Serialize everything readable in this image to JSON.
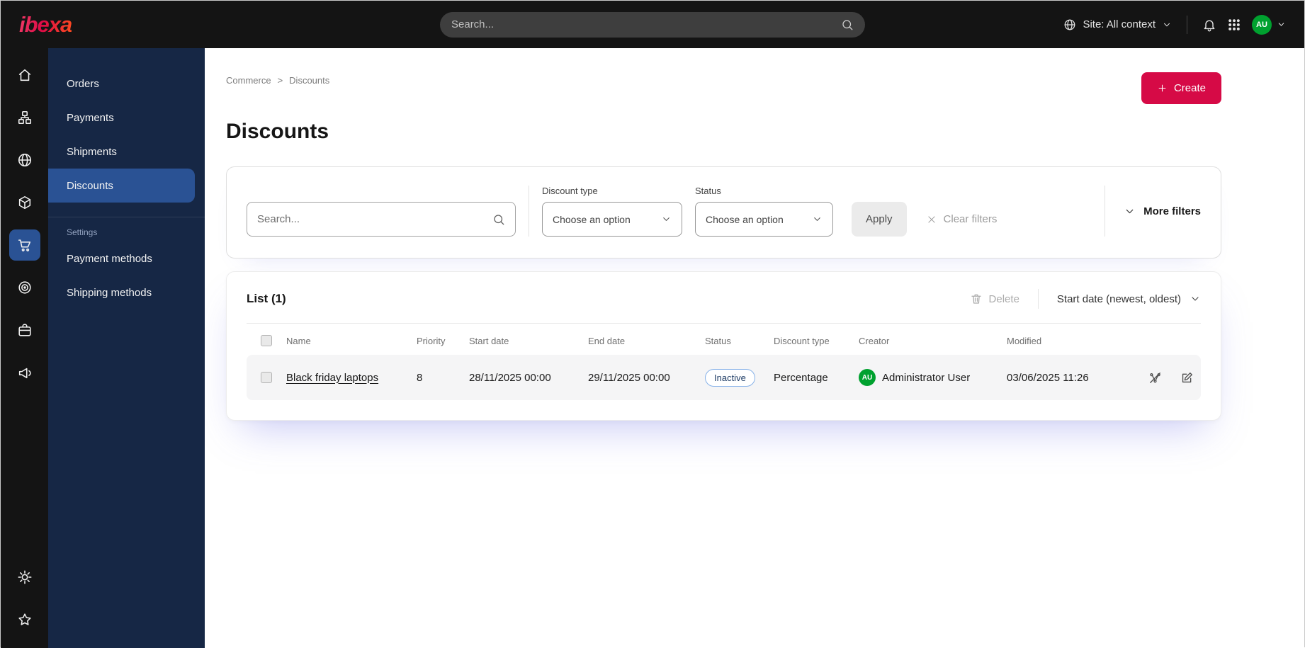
{
  "topbar": {
    "logo": "ibexa",
    "search_placeholder": "Search...",
    "site_context_label": "Site: All context",
    "avatar_initials": "AU"
  },
  "sidebar_rail": {
    "items": [
      "home",
      "content-structure",
      "site",
      "products",
      "commerce",
      "personalization",
      "store",
      "marketing"
    ],
    "active": "commerce",
    "bottom_items": [
      "settings",
      "bookmarks"
    ]
  },
  "menu": {
    "items": [
      {
        "label": "Orders"
      },
      {
        "label": "Payments"
      },
      {
        "label": "Shipments"
      },
      {
        "label": "Discounts"
      }
    ],
    "active_item": "Discounts",
    "settings_section": {
      "label": "Settings",
      "items": [
        {
          "label": "Payment methods"
        },
        {
          "label": "Shipping methods"
        }
      ]
    }
  },
  "breadcrumb": {
    "items": [
      "Commerce",
      "Discounts"
    ],
    "separator": ">"
  },
  "page": {
    "title": "Discounts",
    "create_label": "Create"
  },
  "filters": {
    "search_placeholder": "Search...",
    "discount_type": {
      "label": "Discount type",
      "value": "Choose an option"
    },
    "status": {
      "label": "Status",
      "value": "Choose an option"
    },
    "apply_label": "Apply",
    "clear_label": "Clear filters",
    "more_label": "More filters"
  },
  "list": {
    "heading": "List (1)",
    "delete_label": "Delete",
    "sort_label": "Start date (newest, oldest)",
    "columns": [
      "Name",
      "Priority",
      "Start date",
      "End date",
      "Status",
      "Discount type",
      "Creator",
      "Modified"
    ],
    "rows": [
      {
        "name": "Black friday laptops",
        "priority": "8",
        "start_date": "28/11/2025 00:00",
        "end_date": "29/11/2025 00:00",
        "status": "Inactive",
        "discount_type": "Percentage",
        "creator_initials": "AU",
        "creator": "Administrator User",
        "modified": "03/06/2025 11:26"
      }
    ]
  },
  "icons": {
    "search": "magnifier",
    "globe": "globe",
    "bell": "bell",
    "apps": "3x3-grid",
    "chevron-down": "v",
    "home": "house",
    "content-structure": "sitemap",
    "products": "cube",
    "commerce": "shopping-cart",
    "personalization": "target",
    "store": "briefcase",
    "marketing": "megaphone",
    "settings": "gear",
    "bookmarks": "star",
    "plus": "+",
    "trash": "trash-can",
    "clear": "x",
    "deactivate": "slashed-connection",
    "edit": "pencil-square"
  },
  "colors": {
    "accent": "#d60a46",
    "topbar_bg": "#141414",
    "menu_bg": "#162745",
    "menu_active": "#2a5294",
    "avatar_green": "#00a12f",
    "status_inactive_border": "#86b1e8",
    "row_bg": "#f5f5f6"
  }
}
